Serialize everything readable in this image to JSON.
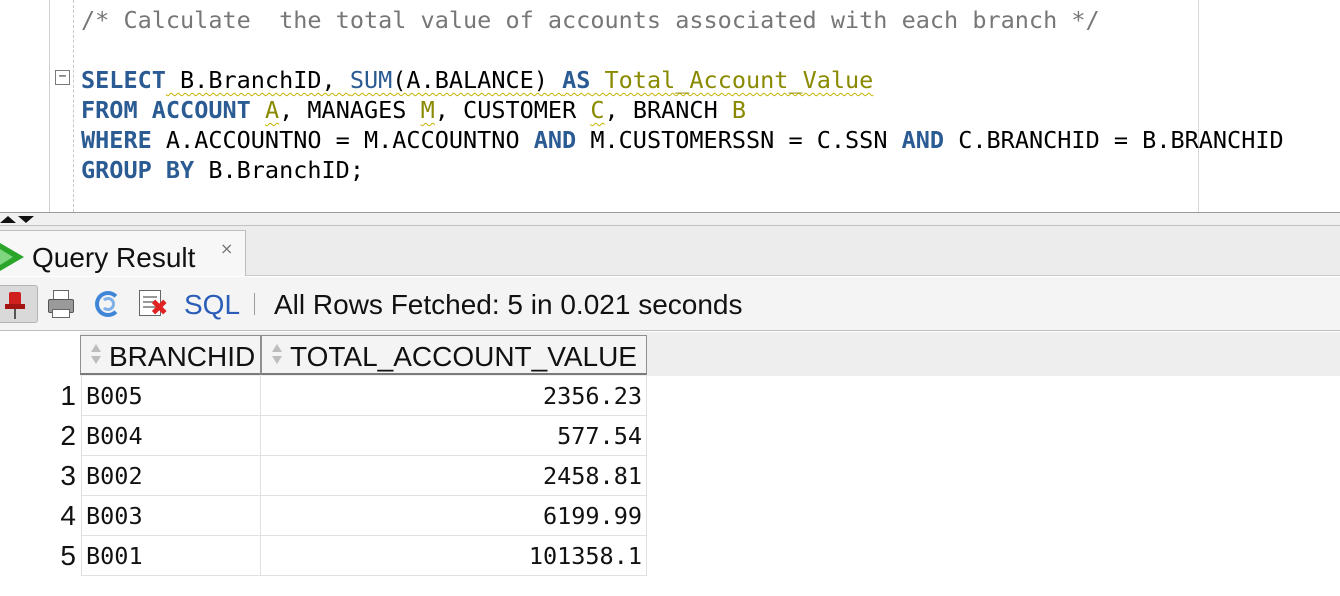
{
  "editor": {
    "comment": "/* Calculate  the total value of accounts associated with each branch */",
    "line_select": {
      "kw_select": "SELECT",
      "text_a": " B.BranchID, ",
      "fn_sum": "SUM",
      "text_b": "(A.BALANCE) ",
      "kw_as": "AS",
      "space": " ",
      "alias": "Total_Account_Value"
    },
    "line_from": {
      "kw_from": "FROM",
      "space1": " ",
      "kw_account": "ACCOUNT",
      "space2": " ",
      "alias_a": "A",
      "text_c": ", MANAGES ",
      "alias_m": "M",
      "text_d": ", CUSTOMER ",
      "alias_c": "C",
      "text_e": ", BRANCH ",
      "alias_b": "B"
    },
    "line_where": {
      "kw_where": "WHERE",
      "text_f": " A.ACCOUNTNO = M.ACCOUNTNO ",
      "kw_and1": "AND",
      "text_g": " M.CUSTOMERSSN = C.SSN ",
      "kw_and2": "AND",
      "text_h": " C.BRANCHID = B.BRANCHID"
    },
    "line_group": {
      "kw_group_by": "GROUP BY",
      "text_i": " B.BranchID;"
    },
    "fold_symbol": "−"
  },
  "result_panel": {
    "tab_label": "Query Result",
    "tab_close": "×",
    "toolbar": {
      "sql_label": "SQL",
      "status_text": "All Rows Fetched: 5 in 0.021 seconds"
    },
    "columns": [
      "BRANCHID",
      "TOTAL_ACCOUNT_VALUE"
    ],
    "rows": [
      {
        "num": "1",
        "branchid": "B005",
        "total": "2356.23"
      },
      {
        "num": "2",
        "branchid": "B004",
        "total": "577.54"
      },
      {
        "num": "3",
        "branchid": "B002",
        "total": "2458.81"
      },
      {
        "num": "4",
        "branchid": "B003",
        "total": "6199.99"
      },
      {
        "num": "5",
        "branchid": "B001",
        "total": "101358.1"
      }
    ]
  },
  "colors": {
    "keyword": "#2b5b93",
    "comment": "#777777",
    "alias": "#8a8a00",
    "run_icon": "#2aa52a",
    "sql_link": "#2a5db8"
  },
  "icons": [
    "pin-icon",
    "print-icon",
    "refresh-icon",
    "clear-icon",
    "run-icon",
    "sort-icon"
  ]
}
